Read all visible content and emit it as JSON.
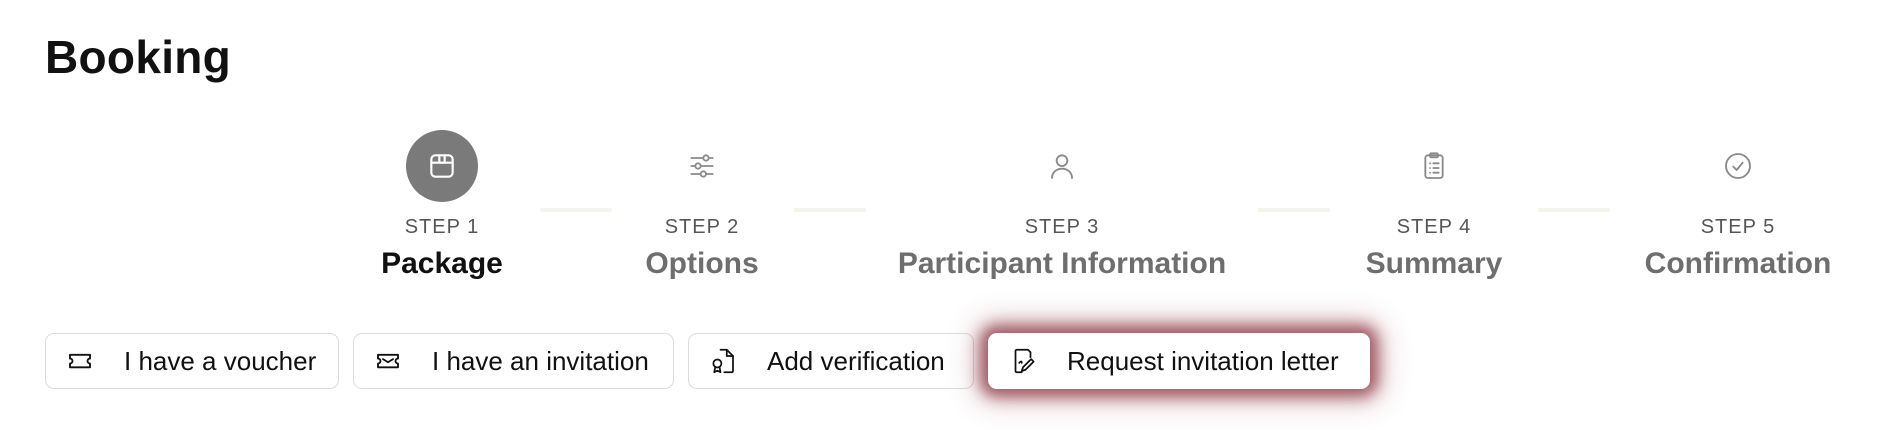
{
  "page": {
    "title": "Booking"
  },
  "stepper": {
    "current": 1,
    "steps": [
      {
        "number": "STEP 1",
        "name": "Package",
        "icon": "package-icon"
      },
      {
        "number": "STEP 2",
        "name": "Options",
        "icon": "sliders-icon"
      },
      {
        "number": "STEP 3",
        "name": "Participant Information",
        "icon": "user-icon"
      },
      {
        "number": "STEP 4",
        "name": "Summary",
        "icon": "clipboard-list-icon"
      },
      {
        "number": "STEP 5",
        "name": "Confirmation",
        "icon": "check-circle-icon"
      }
    ]
  },
  "actions": [
    {
      "label": "I have a voucher",
      "icon": "ticket-icon"
    },
    {
      "label": "I have an invitation",
      "icon": "invitation-ticket-icon"
    },
    {
      "label": "Add verification",
      "icon": "certificate-file-icon"
    },
    {
      "label": "Request invitation letter",
      "icon": "file-signature-icon",
      "highlighted": true
    }
  ],
  "colors": {
    "active_step_bg": "#7a7a7a",
    "highlight_glow": "#801e2d",
    "connector": "#f1f6e9"
  }
}
